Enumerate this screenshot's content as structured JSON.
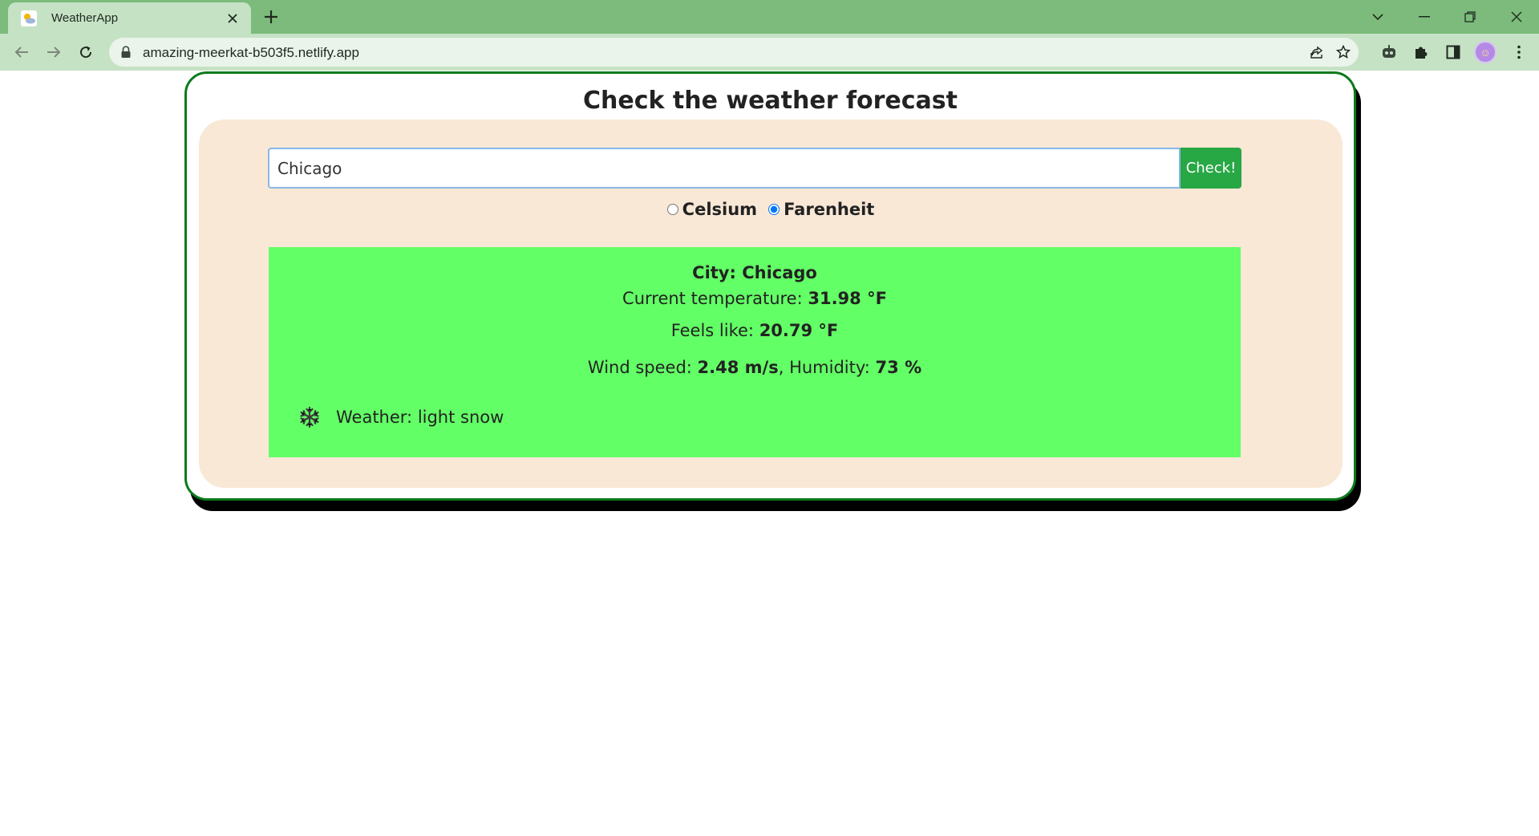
{
  "browser": {
    "tab_title": "WeatherApp",
    "url": "amazing-meerkat-b503f5.netlify.app",
    "icons": {
      "favicon": "weather-favicon-icon",
      "tab_close": "close-icon",
      "new_tab": "plus-icon",
      "tab_search": "chevron-down-icon",
      "minimize": "minimize-icon",
      "restore": "restore-icon",
      "close": "close-icon",
      "back": "arrow-left-icon",
      "forward": "arrow-right-icon",
      "reload": "reload-icon",
      "lock": "lock-icon",
      "share": "share-icon",
      "bookmark": "star-icon",
      "extension_robot": "robot-icon",
      "extensions": "puzzle-icon",
      "side_panel": "side-panel-icon",
      "menu": "kebab-menu-icon"
    },
    "colors": {
      "frame": "#7cbb7b",
      "toolbar": "#c6e2c5"
    }
  },
  "app": {
    "title": "Check the weather forecast",
    "search": {
      "value": "Chicago",
      "button_label": "Check!"
    },
    "units": {
      "celsius_label": "Celsium",
      "fahrenheit_label": "Farenheit",
      "selected": "fahrenheit"
    },
    "result": {
      "city_prefix": "City: ",
      "city": "Chicago",
      "temp_label": "Current temperature: ",
      "temp_value": "31.98 °F",
      "feels_label": "Feels like: ",
      "feels_value": "20.79 °F",
      "wind_label": "Wind speed: ",
      "wind_value": "2.48 m/s",
      "humidity_label": ", Humidity: ",
      "humidity_value": "73 %",
      "weather_label": "Weather: ",
      "weather_value": "light snow",
      "weather_icon": "snowflake-icon"
    },
    "colors": {
      "card_border": "#0a7a1c",
      "panel": "#f9e8d6",
      "result_bg": "#63ff66",
      "button": "#28a745"
    }
  }
}
